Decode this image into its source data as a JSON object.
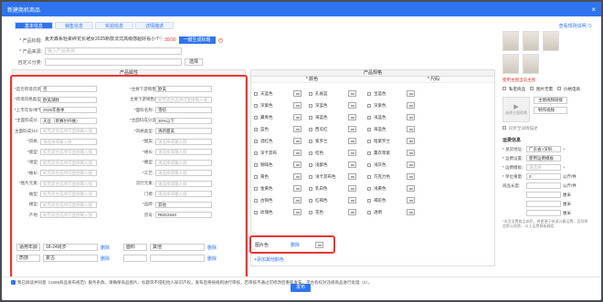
{
  "dialog": {
    "title": "新建商机商品",
    "close_label": "×",
    "tabs": [
      "基本信息",
      "销售信息",
      "实拍信息",
      "详情描述"
    ],
    "top_right_link": "查看规则说明 ⊙"
  },
  "basic": {
    "title_label": "* 产品标题:",
    "title_value": "夏天森系轻柔碎花长裙女2025新款法式高级感超好看小个子短袖",
    "title_count": "30/30",
    "gen_title_btn": "一键生成标题",
    "source_label": "* 产品来源:",
    "source_placeholder": "输入产品来源",
    "custom_cat_label": "自定义分类:",
    "select_btn": "选择"
  },
  "attributes": {
    "panel_title": "产品属性",
    "cells": [
      {
        "label": "*是否跨境货源:",
        "value": "否",
        "placeholder": false
      },
      {
        "label": "*主要下游销售地区1:",
        "value": "欧美",
        "placeholder": false
      },
      {
        "label": "*跨境风格类型:",
        "value": "欧美潮款",
        "placeholder": false
      },
      {
        "label": "主要下游销售地区2:",
        "value": "如无适合选项可直接输入值",
        "placeholder": true
      },
      {
        "label": "*上市年份/季节:",
        "value": "2025年春季",
        "placeholder": false
      },
      {
        "label": "*面料名称:",
        "value": "雪纺",
        "placeholder": false
      },
      {
        "label": "*主面料成分:",
        "value": "天丝（莱赛尔纤维）",
        "placeholder": false
      },
      {
        "label": "*主面料成分含量:",
        "value": "30%以下",
        "placeholder": false
      },
      {
        "label": "主面料成分2:",
        "value": "如无适合选项可直接输入值",
        "placeholder": true
      },
      {
        "label": "*风格类型:",
        "value": "清新甜美",
        "placeholder": false
      },
      {
        "label": "*风格:",
        "value": "请选择或输入值",
        "placeholder": true
      },
      {
        "label": "*图案:",
        "value": "请选择或输入值",
        "placeholder": true
      },
      {
        "label": "*版型:",
        "value": "如无适合选项可直接输入值",
        "placeholder": true
      },
      {
        "label": "*裙长:",
        "value": "请选择或输入值",
        "placeholder": true
      },
      {
        "label": "*领型:",
        "value": "如无适合选项可直接输入值",
        "placeholder": true
      },
      {
        "label": "*腰型:",
        "value": "请选择或输入值",
        "placeholder": true
      },
      {
        "label": "*袖长:",
        "value": "如无适合选项可直接输入值",
        "placeholder": true
      },
      {
        "label": "*工艺:",
        "value": "请选择或输入值",
        "placeholder": true
      },
      {
        "label": "*图片元素:",
        "value": "如无适合选项可直接输入值",
        "placeholder": true
      },
      {
        "label": "流行元素:",
        "value": "请选择或输入值",
        "placeholder": true
      },
      {
        "label": "袖型:",
        "value": "如无适合选项可直接输入值",
        "placeholder": true
      },
      {
        "label": "门襟:",
        "value": "请选择或输入值",
        "placeholder": true
      },
      {
        "label": "裙型:",
        "value": "如无适合选项可直接输入值",
        "placeholder": true
      },
      {
        "label": "*品牌:",
        "value": "其他",
        "placeholder": false
      },
      {
        "label": "产地:",
        "value": "如无适合选项可直接输入值",
        "placeholder": true
      },
      {
        "label": "货号:",
        "value": "RMX2540",
        "placeholder": false
      }
    ],
    "extra_rows": [
      {
        "label": "适用年龄",
        "value": "18-24周岁",
        "action": "删除",
        "label2": "面料",
        "value2": "其他",
        "action2": "删除"
      },
      {
        "label": "质感",
        "value": "复古",
        "action": "删除",
        "label2": "",
        "value2": "",
        "action2": "删除"
      }
    ]
  },
  "colors": {
    "panel_title": "产品规格",
    "col1_header": "* 颜色",
    "col2_header": "* 尺码",
    "items": [
      [
        "天蓝色",
        "孔雀蓝",
        "宝蓝色"
      ],
      [
        "深紫色",
        "深蓝色",
        "深紫色"
      ],
      [
        "藏青色",
        "海蓝色",
        "浅蓝色"
      ],
      [
        "蓝色",
        "西瓜红",
        "海蓝色"
      ],
      [
        "酒红色",
        "紫罗兰",
        "暗紫罗兰"
      ],
      [
        "深卡其布",
        "桔色",
        "薰衣草紫"
      ],
      [
        "咖啡色",
        "浅紫色",
        "浅灰色"
      ],
      [
        "黄色",
        "浅卡其布色",
        "巧克力色"
      ],
      [
        "金黄色",
        "乳白色",
        "浅黄色"
      ],
      [
        "古铜色",
        "红褐色",
        "褐驼色"
      ],
      [
        "玫瑰色",
        "花色",
        "透明"
      ]
    ],
    "selected_label": "图片色",
    "selected_action": "删除",
    "add_more": "+添加其他颜色"
  },
  "side": {
    "upload_label": "使用主图当前主图",
    "options": [
      "私密商品",
      "图片无需",
      "价格电商"
    ],
    "main_video_btn": "主图视频链接",
    "make_video_btn": "制作视频",
    "video_hint": "选择主图视频",
    "apply_label": "同步至详情描述",
    "shipping_title": "运费信息",
    "ship_from_label": "* 发货地址:",
    "ship_from_value": "广东省>深圳...",
    "ship_tpl_label": "* 运费设置:",
    "ship_tpl_value": "使用运费模板",
    "ship_cost_label": "* 运费模板:",
    "ship_cost_value": "请选择",
    "weight_label": "* 单位重量:",
    "weight_value": "0",
    "weight_unit": "公斤/件",
    "len_label": "商品长度:",
    "len_unit": "公斤/件",
    "pkg_len": "厘米",
    "pkg_width": "厘米",
    "pkg_height": "厘米",
    "note": "*本页设置商品体积，将更便于快速计算运费，否则将会默认按第... 以上运费模板确定"
  },
  "footer": {
    "agree_text": "我已阅读并同意《1688商品发布规范》服务条款。请确保商品图片、标题等不侵犯他人知识产权，发布后将按规则进行审核，若审核不通过可修改后重新发布，平台有权对违规商品进行处理（2）。",
    "publish_btn": "发布"
  }
}
